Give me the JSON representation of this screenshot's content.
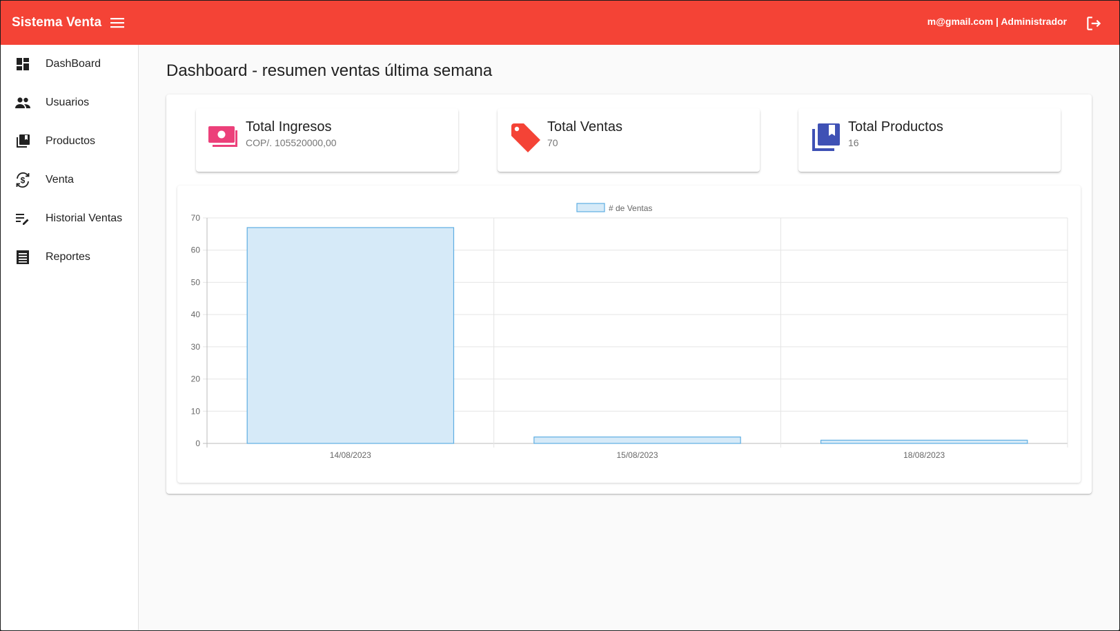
{
  "app": {
    "brand": "Sistema Venta",
    "user": "m@gmail.com | Administrador"
  },
  "sidebar": {
    "items": [
      {
        "label": "DashBoard",
        "icon": "dashboard-icon"
      },
      {
        "label": "Usuarios",
        "icon": "people-icon"
      },
      {
        "label": "Productos",
        "icon": "library-books-icon"
      },
      {
        "label": "Venta",
        "icon": "currency-exchange-icon"
      },
      {
        "label": "Historial Ventas",
        "icon": "playlist-edit-icon"
      },
      {
        "label": "Reportes",
        "icon": "receipt-icon"
      }
    ]
  },
  "main": {
    "title": "Dashboard - resumen ventas última semana"
  },
  "stats": [
    {
      "title": "Total Ingresos",
      "value": "COP/. 105520000,00",
      "icon": "money-icon",
      "color": "#ec407a"
    },
    {
      "title": "Total Ventas",
      "value": "70",
      "icon": "tag-icon",
      "color": "#f44336"
    },
    {
      "title": "Total Productos",
      "value": "16",
      "icon": "library-books-icon",
      "color": "#3f51b5"
    }
  ],
  "colors": {
    "primary": "#f44336",
    "bar_fill": "#d6eaf8",
    "bar_border": "#5dade2"
  },
  "chart_data": {
    "type": "bar",
    "categories": [
      "14/08/2023",
      "15/08/2023",
      "18/08/2023"
    ],
    "series": [
      {
        "name": "# de Ventas",
        "values": [
          67,
          2,
          1
        ]
      }
    ],
    "yticks": [
      "0",
      "10",
      "20",
      "30",
      "40",
      "50",
      "60",
      "70"
    ],
    "ylim": [
      0,
      70
    ],
    "grid": true,
    "legend_position": "top"
  }
}
